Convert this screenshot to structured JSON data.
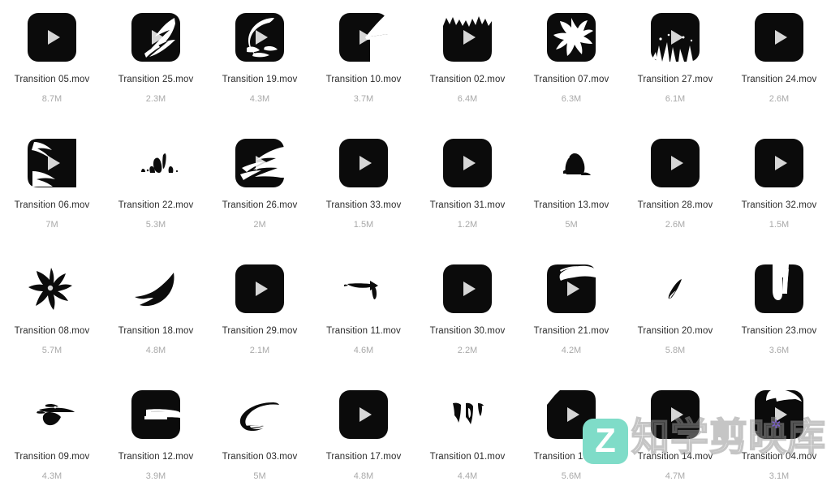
{
  "window": {
    "background_color": "#ffffff",
    "label_color": "#2b2b2b",
    "size_color": "#a9a9a9"
  },
  "watermark": {
    "badge_letter": "Z",
    "badge_color": "#7fdcc8",
    "text": "知学剪映库",
    "gear_icon": "✲",
    "gear_color": "#7b61c9"
  },
  "grid": {
    "columns": 8,
    "rows": 4,
    "files": [
      {
        "name": "Transition 05.mov",
        "size": "8.7M",
        "art": "play_only"
      },
      {
        "name": "Transition 25.mov",
        "size": "2.3M",
        "art": "brush_stroke"
      },
      {
        "name": "Transition 19.mov",
        "size": "4.3M",
        "art": "crescent_splash"
      },
      {
        "name": "Transition 10.mov",
        "size": "3.7M",
        "art": "corner_wipe"
      },
      {
        "name": "Transition 02.mov",
        "size": "6.4M",
        "art": "jagged_top"
      },
      {
        "name": "Transition 07.mov",
        "size": "6.3M",
        "art": "burst_star"
      },
      {
        "name": "Transition 27.mov",
        "size": "6.1M",
        "art": "shards"
      },
      {
        "name": "Transition 24.mov",
        "size": "2.6M",
        "art": "play_only"
      },
      {
        "name": "Transition 06.mov",
        "size": "7M",
        "art": "smoke_streaks"
      },
      {
        "name": "Transition 22.mov",
        "size": "5.3M",
        "art": "small_specks"
      },
      {
        "name": "Transition 26.mov",
        "size": "2M",
        "art": "lightning_scrawl"
      },
      {
        "name": "Transition 33.mov",
        "size": "1.5M",
        "art": "play_only"
      },
      {
        "name": "Transition 31.mov",
        "size": "1.2M",
        "art": "play_only"
      },
      {
        "name": "Transition 13.mov",
        "size": "5M",
        "art": "small_blob"
      },
      {
        "name": "Transition 28.mov",
        "size": "2.6M",
        "art": "play_only"
      },
      {
        "name": "Transition 32.mov",
        "size": "1.5M",
        "art": "play_only"
      },
      {
        "name": "Transition 08.mov",
        "size": "5.7M",
        "art": "ink_splat"
      },
      {
        "name": "Transition 18.mov",
        "size": "4.8M",
        "art": "crescent_sweep"
      },
      {
        "name": "Transition 29.mov",
        "size": "2.1M",
        "art": "play_only"
      },
      {
        "name": "Transition 11.mov",
        "size": "4.6M",
        "art": "small_arrow"
      },
      {
        "name": "Transition 30.mov",
        "size": "2.2M",
        "art": "play_only"
      },
      {
        "name": "Transition 21.mov",
        "size": "4.2M",
        "art": "top_swipe"
      },
      {
        "name": "Transition 20.mov",
        "size": "5.8M",
        "art": "small_sliver"
      },
      {
        "name": "Transition 23.mov",
        "size": "3.6M",
        "art": "u_notch"
      },
      {
        "name": "Transition 09.mov",
        "size": "4.3M",
        "art": "small_spray"
      },
      {
        "name": "Transition 12.mov",
        "size": "3.9M",
        "art": "slash_band"
      },
      {
        "name": "Transition 03.mov",
        "size": "5M",
        "art": "hook_curve"
      },
      {
        "name": "Transition 17.mov",
        "size": "4.8M",
        "art": "play_only"
      },
      {
        "name": "Transition 01.mov",
        "size": "4.4M",
        "art": "drip_marks"
      },
      {
        "name": "Transition 15.mov",
        "size": "5.6M",
        "art": "corner_bite"
      },
      {
        "name": "Transition 14.mov",
        "size": "4.7M",
        "art": "play_only"
      },
      {
        "name": "Transition 04.mov",
        "size": "3.1M",
        "art": "top_cloud"
      }
    ]
  }
}
